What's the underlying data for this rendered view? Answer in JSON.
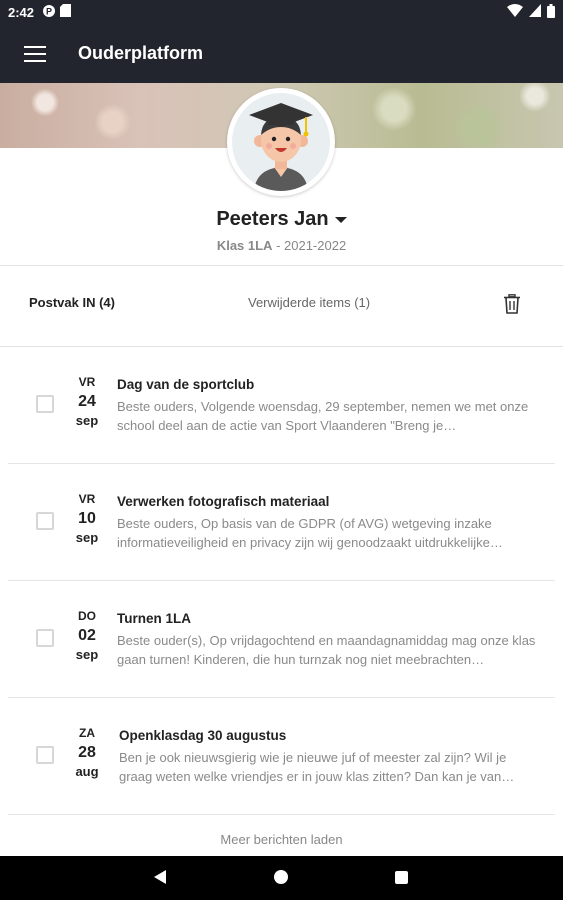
{
  "status_bar": {
    "time": "2:42",
    "icons": [
      "notification-p-icon",
      "sd-card-icon",
      "wifi-icon",
      "signal-icon",
      "battery-icon"
    ]
  },
  "app_bar": {
    "title": "Ouderplatform",
    "menu_icon": "hamburger-menu-icon"
  },
  "profile": {
    "name": "Peeters Jan",
    "class_label": "Klas 1LA",
    "separator": " - ",
    "school_year": "2021-2022",
    "avatar_icon": "graduate-avatar-icon"
  },
  "tabs": {
    "inbox": "Postvak IN (4)",
    "deleted": "Verwijderde items (1)",
    "trash_icon": "trash-icon"
  },
  "messages": [
    {
      "dow": "VR",
      "day": "24",
      "month": "sep",
      "subject": "Dag van de sportclub",
      "preview": "Beste ouders,   Volgende woensdag, 29 september, nemen we met onze school deel aan de actie van Sport Vlaanderen \"Breng je…"
    },
    {
      "dow": "VR",
      "day": "10",
      "month": "sep",
      "subject": "Verwerken fotografisch materiaal",
      "preview": "Beste ouders, Op basis van de GDPR (of AVG) wetgeving inzake informatieveiligheid en privacy zijn wij genoodzaakt uitdrukkelijke…"
    },
    {
      "dow": "DO",
      "day": "02",
      "month": "sep",
      "subject": "Turnen 1LA",
      "preview": "Beste ouder(s), Op vrijdagochtend en maandagnamiddag mag onze klas gaan turnen! Kinderen, die hun turnzak nog niet meebrachten…"
    },
    {
      "dow": "ZA",
      "day": "28",
      "month": "aug",
      "subject": "Openklasdag 30 augustus",
      "preview": "Ben je ook nieuwsgierig wie je nieuwe juf of meester zal zijn? Wil je graag weten welke vriendjes er in jouw klas zitten? Dan kan je van…"
    }
  ],
  "load_more": "Meer berichten laden",
  "nav_bar": {
    "icons": [
      "back-icon",
      "home-icon",
      "recents-icon"
    ]
  },
  "colors": {
    "app_bar": "#22252d",
    "text_primary": "#222222",
    "text_secondary": "#8a8a8a"
  }
}
